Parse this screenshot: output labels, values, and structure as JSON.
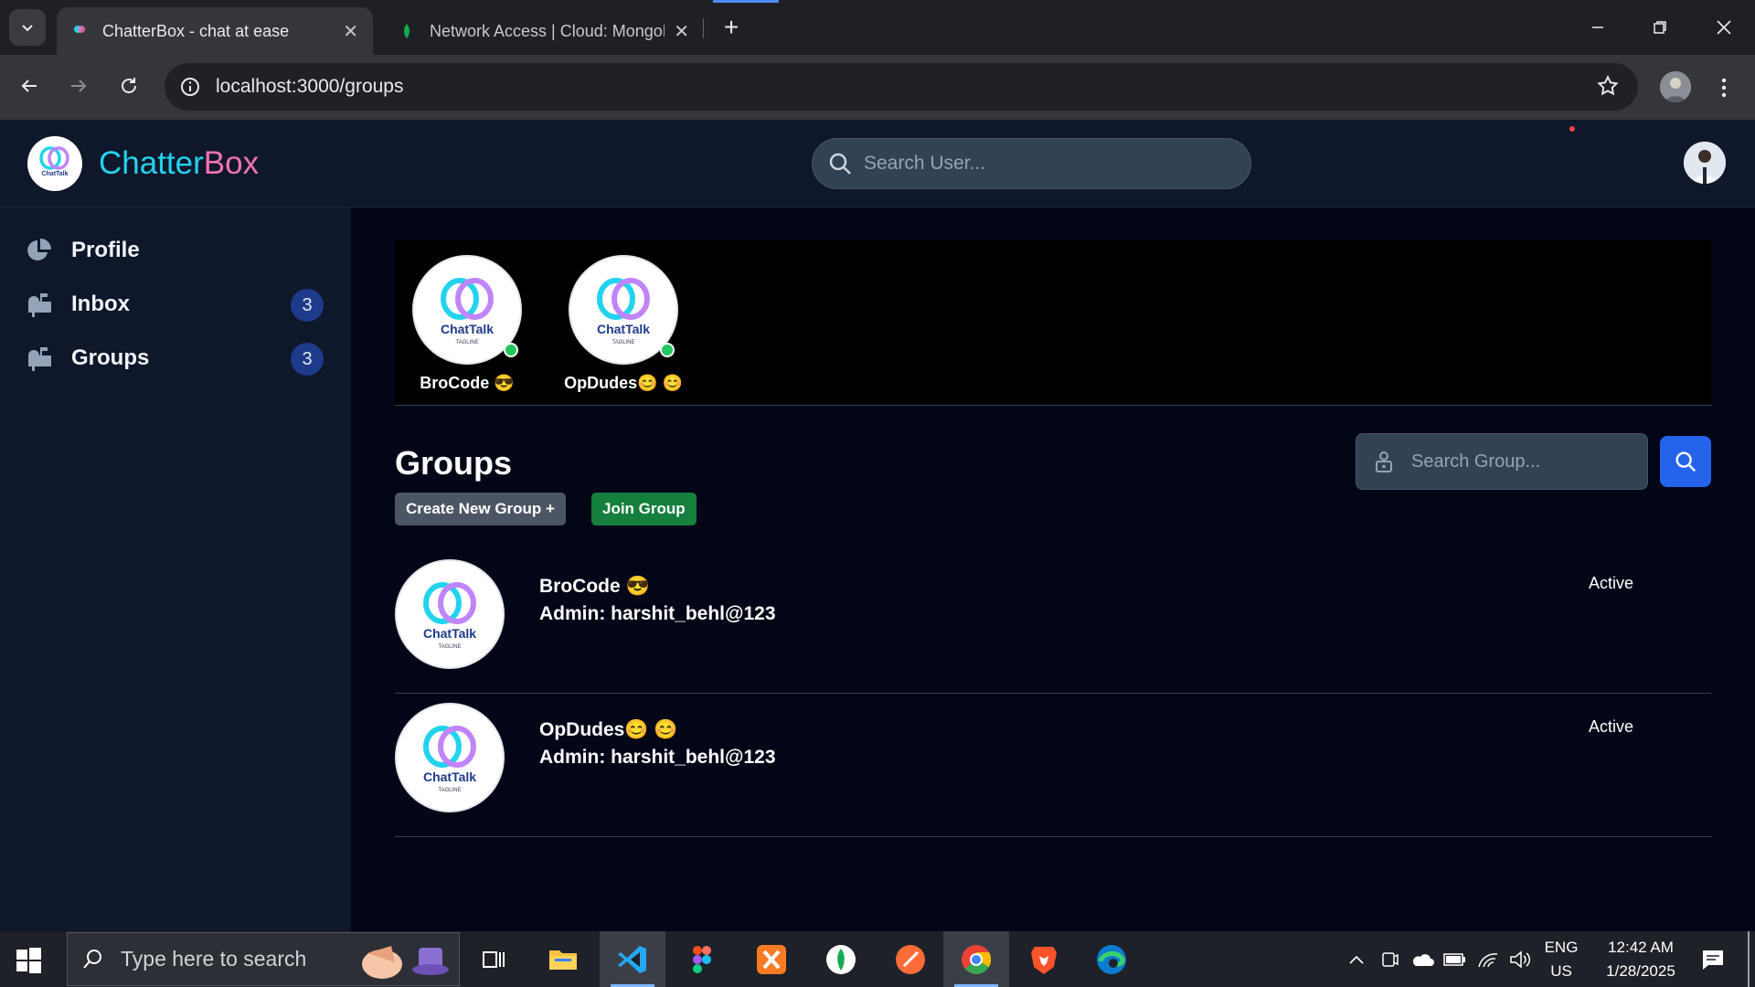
{
  "browser": {
    "tabs": [
      {
        "title": "ChatterBox - chat at ease"
      },
      {
        "title": "Network Access | Cloud: MongoDB"
      }
    ],
    "url": "localhost:3000/groups"
  },
  "app": {
    "brand_part1": "Chatter",
    "brand_part2": "Box",
    "logo_text": "ChatTalk",
    "logo_tagline": "TAGLINE",
    "search_user_placeholder": "Search User..."
  },
  "sidebar": {
    "items": [
      {
        "label": "Profile",
        "icon": "pie-chart-icon"
      },
      {
        "label": "Inbox",
        "icon": "mailbox-icon",
        "badge": "3"
      },
      {
        "label": "Groups",
        "icon": "mailbox-icon",
        "badge": "3"
      }
    ]
  },
  "stories": [
    {
      "name": "BroCode 😎"
    },
    {
      "name": "OpDudes😊 😊"
    }
  ],
  "groups_page": {
    "title": "Groups",
    "create_button": "Create New Group +",
    "join_button": "Join Group",
    "search_placeholder": "Search Group..."
  },
  "groups": [
    {
      "name": "BroCode 😎",
      "admin": "Admin: harshit_behl@123",
      "status": "Active"
    },
    {
      "name": "OpDudes😊 😊",
      "admin": "Admin: harshit_behl@123",
      "status": "Active"
    }
  ],
  "taskbar": {
    "search_placeholder": "Type here to search",
    "lang_line1": "ENG",
    "lang_line2": "US",
    "time": "12:42 AM",
    "date": "1/28/2025"
  },
  "colors": {
    "brand_cyan": "#22d3ee",
    "brand_pink": "#f472b6",
    "online": "#22c55e",
    "join_green": "#15803d",
    "search_blue": "#2563eb"
  }
}
